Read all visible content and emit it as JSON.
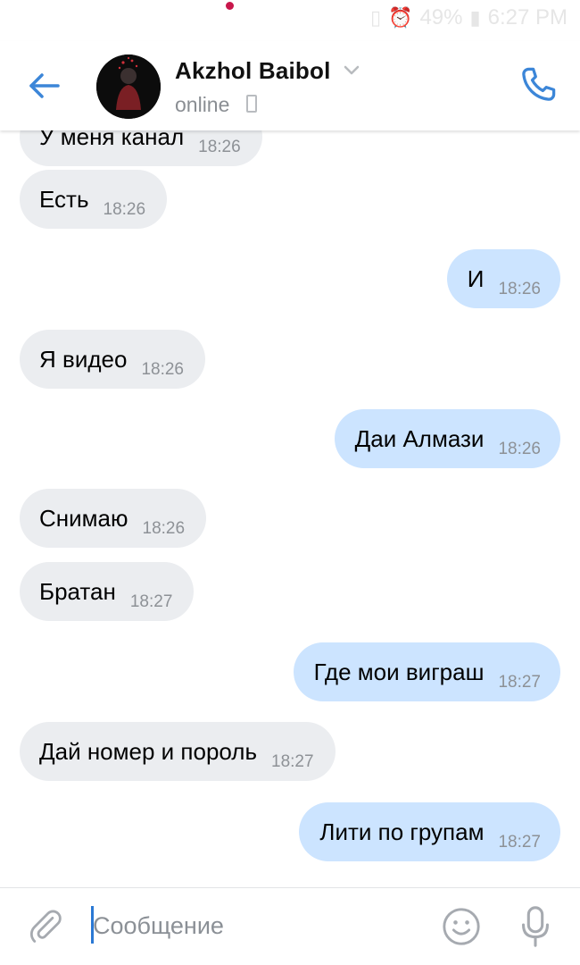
{
  "status_bar": {
    "battery": "49%",
    "time": "6:27 PM",
    "icons": [
      "vibrate-icon",
      "alarm-icon",
      "battery-icon"
    ],
    "notification_color": "#c8174b"
  },
  "header": {
    "contact_name": "Akzhol Baibol",
    "status": "online",
    "icons": [
      "back-arrow-icon",
      "chevron-down-icon",
      "mobile-device-icon",
      "phone-icon"
    ],
    "accent": "#3c86d8"
  },
  "messages": [
    {
      "text": "У меня канал",
      "time": "18:26",
      "direction": "in"
    },
    {
      "text": "Есть",
      "time": "18:26",
      "direction": "in"
    },
    {
      "text": "И",
      "time": "18:26",
      "direction": "out"
    },
    {
      "text": "Я видео",
      "time": "18:26",
      "direction": "in"
    },
    {
      "text": "Даи Алмази",
      "time": "18:26",
      "direction": "out"
    },
    {
      "text": "Снимаю",
      "time": "18:26",
      "direction": "in"
    },
    {
      "text": "Братан",
      "time": "18:27",
      "direction": "in"
    },
    {
      "text": "Где мои виграш",
      "time": "18:27",
      "direction": "out"
    },
    {
      "text": "Дай номер и пороль",
      "time": "18:27",
      "direction": "in"
    },
    {
      "text": "Лити по групам",
      "time": "18:27",
      "direction": "out"
    }
  ],
  "composer": {
    "placeholder": "Сообщение",
    "value": "",
    "icons": [
      "paperclip-icon",
      "emoji-icon",
      "microphone-icon"
    ]
  },
  "colors": {
    "incoming_bubble": "#ebedf0",
    "outgoing_bubble": "#cce4ff",
    "timestamp": "#8d9196"
  }
}
